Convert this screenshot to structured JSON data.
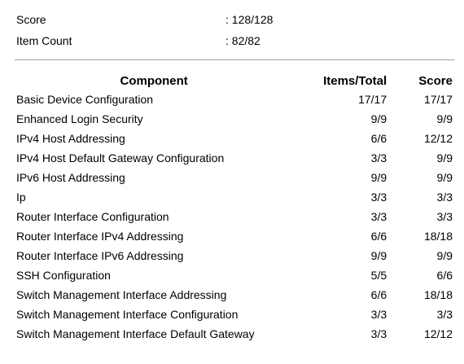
{
  "summary": {
    "score_label": "Score",
    "score_value": ": 128/128",
    "item_count_label": "Item Count",
    "item_count_value": ": 82/82"
  },
  "table": {
    "headers": {
      "component": "Component",
      "items_total": "Items/Total",
      "score": "Score"
    },
    "rows": [
      {
        "component": "Basic Device Configuration",
        "items": "17/17",
        "score": "17/17"
      },
      {
        "component": "Enhanced Login Security",
        "items": "9/9",
        "score": "9/9"
      },
      {
        "component": "IPv4 Host Addressing",
        "items": "6/6",
        "score": "12/12"
      },
      {
        "component": "IPv4 Host Default Gateway Configuration",
        "items": "3/3",
        "score": "9/9"
      },
      {
        "component": "IPv6 Host Addressing",
        "items": "9/9",
        "score": "9/9"
      },
      {
        "component": "Ip",
        "items": "3/3",
        "score": "3/3"
      },
      {
        "component": "Router Interface Configuration",
        "items": "3/3",
        "score": "3/3"
      },
      {
        "component": "Router Interface IPv4 Addressing",
        "items": "6/6",
        "score": "18/18"
      },
      {
        "component": "Router Interface IPv6 Addressing",
        "items": "9/9",
        "score": "9/9"
      },
      {
        "component": "SSH Configuration",
        "items": "5/5",
        "score": "6/6"
      },
      {
        "component": "Switch Management Interface Addressing",
        "items": "6/6",
        "score": "18/18"
      },
      {
        "component": "Switch Management Interface Configuration",
        "items": "3/3",
        "score": "3/3"
      },
      {
        "component": "Switch Management Interface Default Gateway",
        "items": "3/3",
        "score": "12/12"
      }
    ]
  }
}
